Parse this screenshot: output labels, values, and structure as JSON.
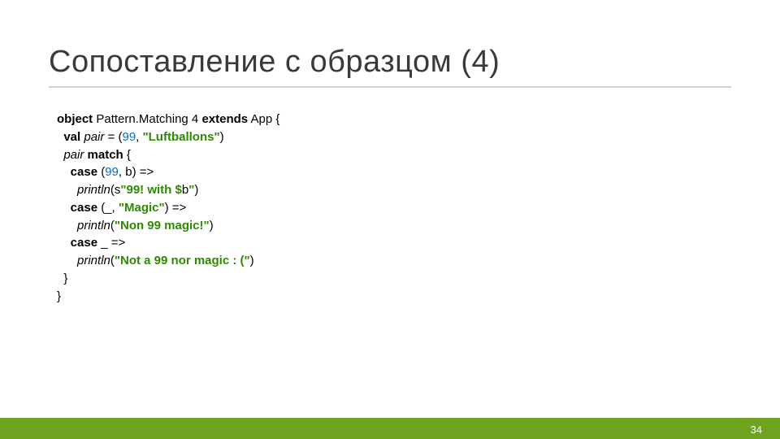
{
  "slide": {
    "title": "Сопоставление с образцом (4)",
    "page_number": "34"
  },
  "code": {
    "l1_kw1": "object",
    "l1_name": " Pattern.Matching 4 ",
    "l1_kw2": "extends",
    "l1_rest": " App {",
    "l2_indent": "  ",
    "l2_kw": "val ",
    "l2_var": "pair",
    "l2_eq": " = (",
    "l2_num": "99",
    "l2_comma": ", ",
    "l2_str": "\"Luftballons\"",
    "l2_close": ")",
    "l3_indent": "  ",
    "l3_var": "pair",
    "l3_sp": " ",
    "l3_kw": "match",
    "l3_brace": " {",
    "l4_indent": "    ",
    "l4_kw": "case",
    "l4_open": " (",
    "l4_num": "99",
    "l4_rest": ", b) =>",
    "l5_indent": "      ",
    "l5_fn": "println",
    "l5_open": "(s",
    "l5_s1": "\"99! with $",
    "l5_mid": "b",
    "l5_s2": "\"",
    "l5_close": ")",
    "l6_indent": "    ",
    "l6_kw": "case",
    "l6_open": " (_, ",
    "l6_str": "\"Magic\"",
    "l6_close": ") =>",
    "l7_indent": "      ",
    "l7_fn": "println",
    "l7_open": "(",
    "l7_str": "\"Non 99 magic!\"",
    "l7_close": ")",
    "l8_indent": "    ",
    "l8_kw": "case",
    "l8_rest": " _ =>",
    "l9_indent": "      ",
    "l9_fn": "println",
    "l9_open": "(",
    "l9_str": "\"Not a 99 nor magic : (\"",
    "l9_close": ")",
    "l10": "  }",
    "l11": "}"
  }
}
